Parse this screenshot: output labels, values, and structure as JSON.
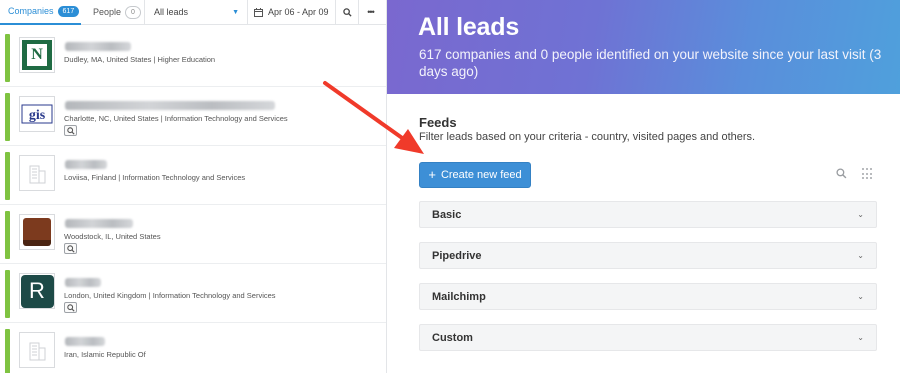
{
  "tabs": {
    "companies_label": "Companies",
    "companies_count": "617",
    "people_label": "People",
    "people_count": "0"
  },
  "filter": {
    "selected": "All leads"
  },
  "date_range": "Apr 06 - Apr 09",
  "icons": {
    "search": "search-icon",
    "more": "more-icon",
    "calendar": "calendar-icon"
  },
  "leads": [
    {
      "location": "Dudley, MA, United States",
      "industry": "Higher Education",
      "logo": "n-logo"
    },
    {
      "location": "Charlotte, NC, United States",
      "industry": "Information Technology and Services",
      "logo": "gis-logo"
    },
    {
      "location": "Loviisa, Finland",
      "industry": "Information Technology and Services",
      "logo": "building-placeholder"
    },
    {
      "location": "Woodstock, IL, United States",
      "industry": "",
      "logo": "pot-logo"
    },
    {
      "location": "London, United Kingdom",
      "industry": "Information Technology and Services",
      "logo": "r-logo"
    },
    {
      "location": "Iran, Islamic Republic Of",
      "industry": "",
      "logo": "building-placeholder"
    }
  ],
  "hero": {
    "title": "All leads",
    "subtitle": "617 companies and 0 people identified on your website since your last visit (3 days ago)"
  },
  "feeds": {
    "title": "Feeds",
    "description": "Filter leads based on your criteria - country, visited pages and others.",
    "create_label": "Create new feed",
    "items": [
      {
        "label": "Basic"
      },
      {
        "label": "Pipedrive"
      },
      {
        "label": "Mailchimp"
      },
      {
        "label": "Custom"
      }
    ]
  },
  "colors": {
    "accent": "#2b8ed6",
    "lead_bar": "#7fc341",
    "annotation_arrow": "#f03a2a",
    "hero_start": "#7a68cf",
    "hero_end": "#4fa0dc"
  }
}
